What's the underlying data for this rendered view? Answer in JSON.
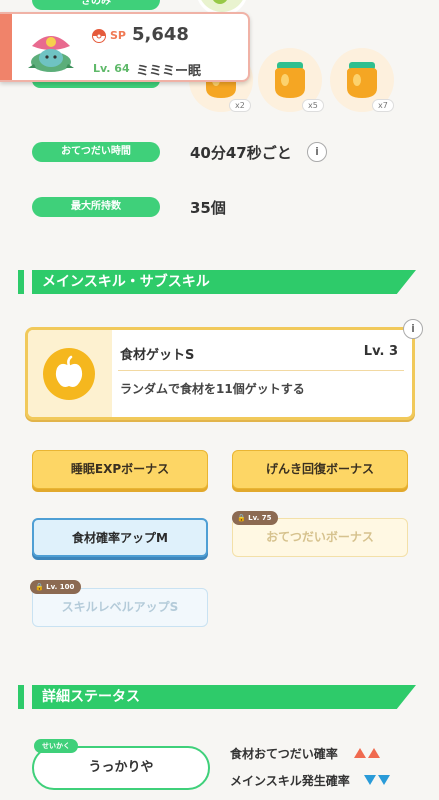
{
  "top": {
    "label_partial": "きのみ"
  },
  "pokemon": {
    "sp_label": "SP",
    "sp_value": "5,648",
    "level": "Lv. 64",
    "name": "ミミミー眠"
  },
  "ingredients": [
    {
      "icon": "honey-jar-icon",
      "count": "x2"
    },
    {
      "icon": "honey-jar-icon",
      "count": "x5"
    },
    {
      "icon": "honey-jar-icon",
      "count": "x7"
    }
  ],
  "stats": {
    "help_time_label": "おてつだい時間",
    "help_time_value": "40分47秒ごと",
    "max_carry_label": "最大所持数",
    "max_carry_value": "35個",
    "info_glyph": "i"
  },
  "skills_section": {
    "title": "メインスキル・サブスキル",
    "main_skill": {
      "name": "食材ゲットS",
      "level": "Lv. 3",
      "description": "ランダムで食材を11個ゲットする"
    },
    "sub_skills": [
      {
        "label": "睡眠EXPボーナス",
        "style": "gold",
        "locked": false
      },
      {
        "label": "げんき回復ボーナス",
        "style": "gold",
        "locked": false
      },
      {
        "label": "食材確率アップM",
        "style": "blue",
        "locked": false
      },
      {
        "label": "おてつだいボーナス",
        "style": "gold",
        "locked": true,
        "unlock_level": "Lv. 75"
      },
      {
        "label": "スキルレベルアップS",
        "style": "blue",
        "locked": true,
        "unlock_level": "Lv. 100"
      }
    ]
  },
  "detail_section": {
    "title": "詳細ステータス",
    "nature_tag": "せいかく",
    "nature_value": "うっかりや",
    "nature_up": "食材おてつだい確率",
    "nature_down": "メインスキル発生確率"
  },
  "colors": {
    "accent_green": "#3fd07a",
    "gold": "#fdd665",
    "blue": "#4f9fd4",
    "up": "#f06a4f",
    "down": "#2a9bd8"
  }
}
